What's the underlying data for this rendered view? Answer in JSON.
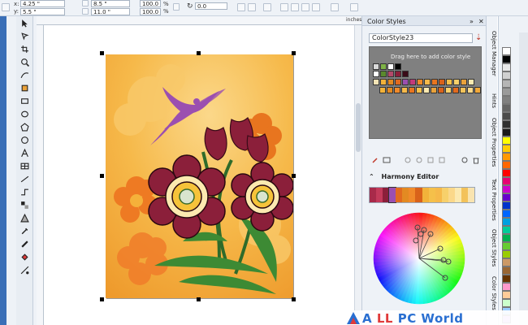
{
  "property_bar": {
    "x_label": "x:",
    "x_value": "4.25 \"",
    "y_label": "y:",
    "y_value": "5.5 \"",
    "width_value": "8.5 \"",
    "height_value": "11.0 \"",
    "scale_x": "100.0",
    "scale_y": "100.0",
    "percent_symbol": "%",
    "angle_value": "0.0",
    "units_label": "inches"
  },
  "docker": {
    "title": "Color Styles",
    "style_name": "ColorStyle23",
    "drop_hint": "Drag here to add color style",
    "harmony_title": "Harmony Editor",
    "tabs": [
      "Object Manager",
      "Hints",
      "Object Properties",
      "Text Properties",
      "Object Styles",
      "Color Styles"
    ]
  },
  "palette_colors": [
    "#ffffff",
    "#000000",
    "#e8e8e8",
    "#d0d0d0",
    "#b5b5b5",
    "#9a9a9a",
    "#808080",
    "#656565",
    "#4b4b4b",
    "#303030",
    "#1a1a1a",
    "#ffff00",
    "#ffcc00",
    "#ff9900",
    "#ff6600",
    "#ff0000",
    "#e60073",
    "#cc00cc",
    "#6600cc",
    "#0033cc",
    "#0066ff",
    "#00a0e0",
    "#00cc99",
    "#00b050",
    "#66cc33",
    "#99cc00",
    "#cc9966",
    "#996633",
    "#663300",
    "#ff99cc",
    "#ffcc99",
    "#ccffcc",
    "#99ccff",
    "#cc99ff"
  ],
  "watermark": {
    "prefix": "A",
    "middle": "LL",
    "suffix": "PC World"
  },
  "colors": {
    "accent": "#3a6fb7",
    "page_bg": "#f5b13a"
  }
}
